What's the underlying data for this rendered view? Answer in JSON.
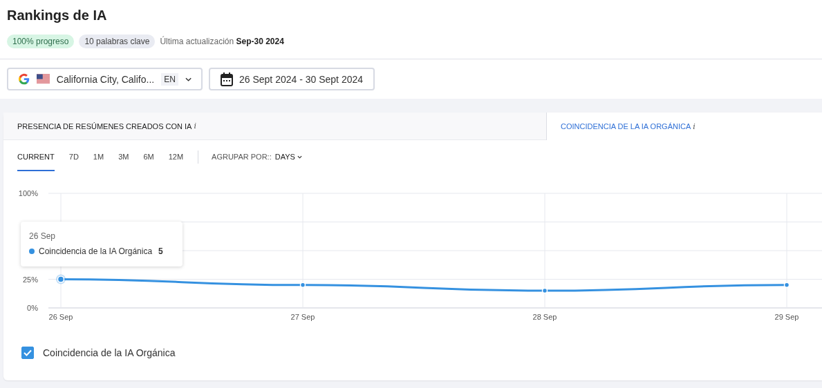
{
  "title": "Rankings de IA",
  "badges": [
    {
      "text": "100% progreso",
      "kind": "success"
    },
    {
      "text": "10 palabras clave",
      "kind": "neutral"
    }
  ],
  "last_update": {
    "label": "Última actualización",
    "value": "Sep-30 2024"
  },
  "location_select": {
    "value": "California City, Califo...",
    "language": "EN"
  },
  "date_range": "26 Sept 2024 - 30 Sept 2024",
  "tabs": [
    {
      "label": "PRESENCIA DE RESÚMENES CREADOS CON IA",
      "info": "i",
      "selected": false
    },
    {
      "label": "COINCIDENCIA DE LA IA ORGÁNICA",
      "info": "i",
      "selected": true
    }
  ],
  "periods": [
    {
      "label": "CURRENT",
      "selected": true
    },
    {
      "label": "7D",
      "selected": false
    },
    {
      "label": "1M",
      "selected": false
    },
    {
      "label": "3M",
      "selected": false
    },
    {
      "label": "6M",
      "selected": false
    },
    {
      "label": "12M",
      "selected": false
    }
  ],
  "group_by": {
    "label": "AGRUPAR POR::",
    "value": "DAYS"
  },
  "chart_data": {
    "type": "line",
    "categories": [
      "26 Sep",
      "27 Sep",
      "28 Sep",
      "29 Sep"
    ],
    "series": [
      {
        "name": "Coincidencia de la IA Orgánica",
        "color": "#3591e0",
        "marker": "circle",
        "values": [
          25,
          20,
          15,
          20
        ]
      }
    ],
    "grid": true,
    "ylim": [
      0,
      100
    ],
    "yticks": [
      {
        "value": 0,
        "label": "0%"
      },
      {
        "value": 25,
        "label": "25%"
      },
      {
        "value": 100,
        "label": "100%"
      }
    ]
  },
  "tooltip": {
    "date": "26 Sep",
    "value": "5"
  },
  "legend": [
    {
      "label": "Coincidencia de la IA Orgánica",
      "checked": true,
      "color": "#3591e0"
    }
  ]
}
